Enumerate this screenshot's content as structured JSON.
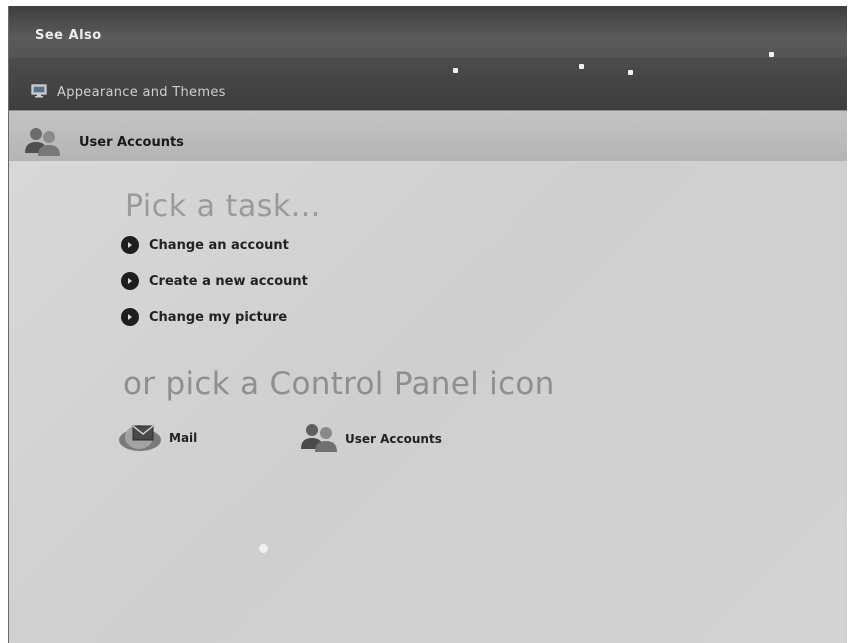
{
  "see_also": {
    "title": "See Also",
    "link_label": "Appearance and Themes",
    "link_icon": "display-properties-icon"
  },
  "header": {
    "title": "User Accounts",
    "icon": "user-accounts-icon"
  },
  "tasks": {
    "heading": "Pick a task...",
    "items": [
      {
        "label": "Change an account"
      },
      {
        "label": "Create a new account"
      },
      {
        "label": "Change my picture"
      }
    ]
  },
  "control_panel": {
    "heading": "or pick a Control Panel icon",
    "icons": [
      {
        "label": "Mail",
        "icon": "mail-icon"
      },
      {
        "label": "User Accounts",
        "icon": "user-accounts-icon"
      }
    ]
  },
  "colors": {
    "sidebar_dark": "#3e3e3e",
    "header_band": "#bdbdbd",
    "content_bg": "#d6d6d6",
    "heading_gray": "#9a9a9a"
  }
}
